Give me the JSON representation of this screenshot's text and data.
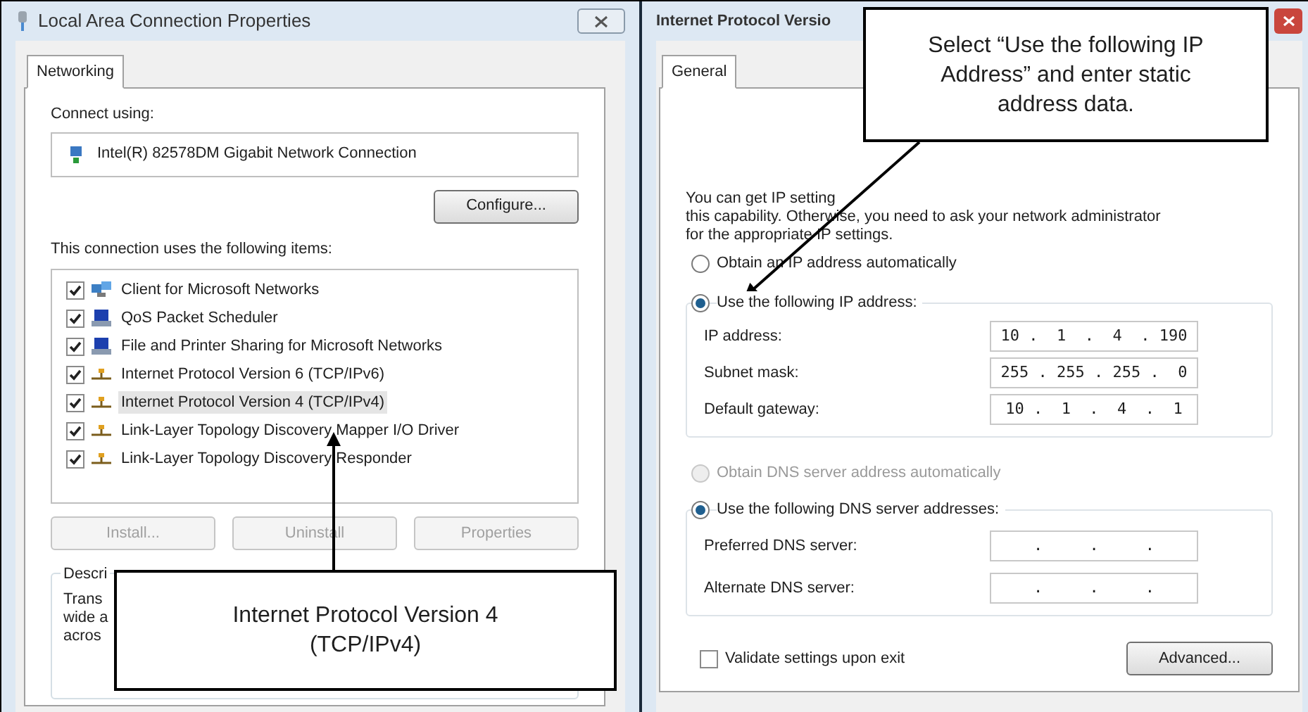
{
  "left_dialog": {
    "title": "Local Area Connection Properties",
    "tabs": [
      {
        "label": "Networking",
        "selected": true
      }
    ],
    "connect_using_label": "Connect using:",
    "adapter": "Intel(R) 82578DM Gigabit Network Connection",
    "configure_button": {
      "label": "Configure...",
      "disabled": false
    },
    "items_label": "This connection uses the following items:",
    "items": [
      {
        "label": "Client for Microsoft Networks",
        "kind": "client",
        "checked": true,
        "selected": false
      },
      {
        "label": "QoS Packet Scheduler",
        "kind": "service",
        "checked": true,
        "selected": false
      },
      {
        "label": "File and Printer Sharing for Microsoft Networks",
        "kind": "service",
        "checked": true,
        "selected": false
      },
      {
        "label": "Internet Protocol Version 6 (TCP/IPv6)",
        "kind": "protocol",
        "checked": true,
        "selected": false
      },
      {
        "label": "Internet Protocol Version 4 (TCP/IPv4)",
        "kind": "protocol",
        "checked": true,
        "selected": true
      },
      {
        "label": "Link-Layer Topology Discovery Mapper I/O Driver",
        "kind": "protocol",
        "checked": true,
        "selected": false
      },
      {
        "label": "Link-Layer Topology Discovery Responder",
        "kind": "protocol",
        "checked": true,
        "selected": false
      }
    ],
    "buttons": [
      {
        "label": "Install...",
        "disabled": true
      },
      {
        "label": "Uninstall",
        "disabled": true
      },
      {
        "label": "Properties",
        "disabled": true
      }
    ],
    "description_label": "Descri",
    "description_lines": [
      "Trans",
      "wide a",
      "acros"
    ]
  },
  "right_dialog": {
    "title": "Internet Protocol Versio",
    "tabs": [
      {
        "label": "General",
        "selected": true
      }
    ],
    "intro_lines": [
      "You can get IP setting",
      "this capability. Otherwise, you need to ask your network administrator",
      "for the appropriate IP settings."
    ],
    "ip_mode": [
      {
        "label": "Obtain an IP address automatically",
        "selected": false,
        "disabled": false
      },
      {
        "label": "Use the following IP address:",
        "selected": true,
        "disabled": false
      }
    ],
    "ip_fields": [
      {
        "label": "IP address:",
        "value": "10 .  1  .  4  . 190"
      },
      {
        "label": "Subnet mask:",
        "value": "255 . 255 . 255 .  0"
      },
      {
        "label": "Default gateway:",
        "value": "10 .  1  .  4  .  1"
      }
    ],
    "dns_mode": [
      {
        "label": "Obtain DNS server address automatically",
        "selected": false,
        "disabled": true
      },
      {
        "label": "Use the following DNS server addresses:",
        "selected": true,
        "disabled": false
      }
    ],
    "dns_fields": [
      {
        "label": "Preferred DNS server:",
        "value": ".     .     ."
      },
      {
        "label": "Alternate DNS server:",
        "value": ".     .     ."
      }
    ],
    "validate": {
      "label": "Validate settings upon exit",
      "checked": false
    },
    "advanced_button": "Advanced..."
  },
  "annotations": [
    {
      "text": "Internet Protocol Version 4 (TCP/IPv4)"
    },
    {
      "text": "Select “Use the following IP Address” and enter static address data."
    }
  ]
}
